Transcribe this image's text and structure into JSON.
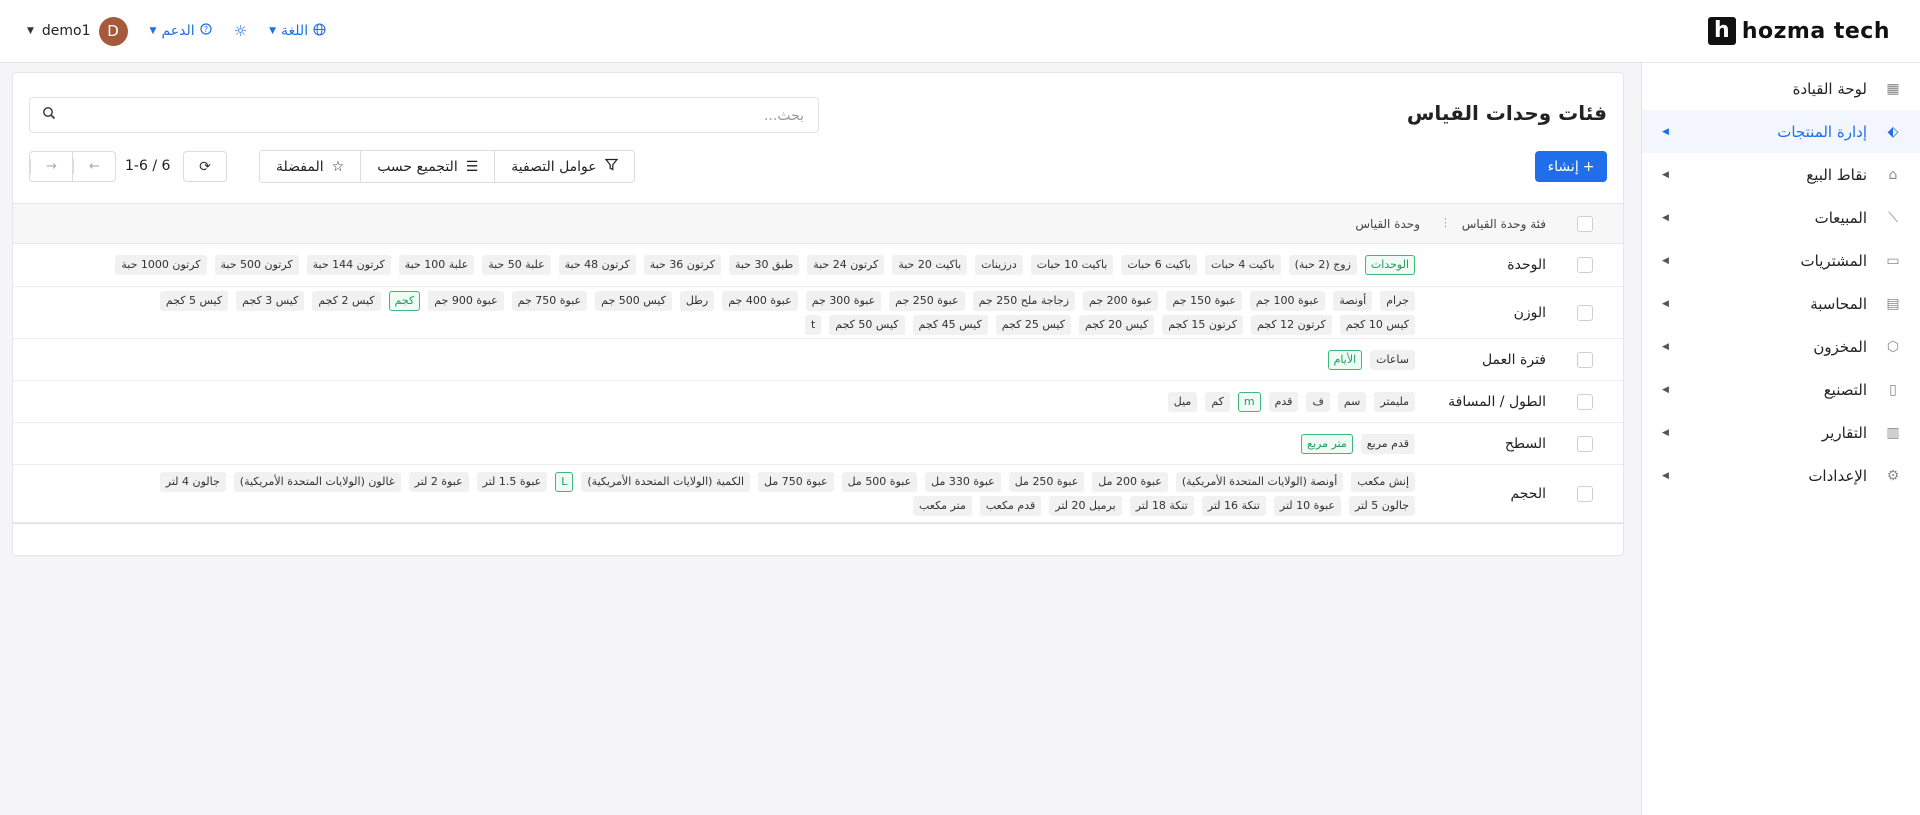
{
  "brand": {
    "logo_letter": "h",
    "name": "hozma tech"
  },
  "topbar": {
    "user_name": "demo1",
    "avatar_letter": "D",
    "support_label": "الدعم",
    "language_label": "اللغة"
  },
  "sidebar": {
    "items": [
      {
        "label": "لوحة القيادة",
        "icon": "grid-icon"
      },
      {
        "label": "إدارة المنتجات",
        "icon": "tag-icon",
        "active": true
      },
      {
        "label": "نقاط البيع",
        "icon": "store-icon"
      },
      {
        "label": "المبيعات",
        "icon": "chart-line-icon"
      },
      {
        "label": "المشتريات",
        "icon": "wallet-icon"
      },
      {
        "label": "المحاسبة",
        "icon": "ledger-icon"
      },
      {
        "label": "المخزون",
        "icon": "box-icon"
      },
      {
        "label": "التصنيع",
        "icon": "document-icon"
      },
      {
        "label": "التقارير",
        "icon": "report-icon"
      },
      {
        "label": "الإعدادات",
        "icon": "gear-icon"
      }
    ]
  },
  "page": {
    "title": "فئات وحدات القياس",
    "search_placeholder": "بحث...",
    "create_label": "إنشاء",
    "filters_label": "عوامل التصفية",
    "groupby_label": "التجميع حسب",
    "favorites_label": "المفضلة",
    "pager_text": "1-6 / 6"
  },
  "table": {
    "headers": {
      "name": "فئة وحدة القياس",
      "units": "وحدة القياس"
    },
    "rows": [
      {
        "name": "الوحدة",
        "units": [
          {
            "t": "الوحدات",
            "ref": true
          },
          {
            "t": "زوج (2 حبة)"
          },
          {
            "t": "باكيت 4 حبات"
          },
          {
            "t": "باكيت 6 حبات"
          },
          {
            "t": "باكيت 10 حبات"
          },
          {
            "t": "درزينات"
          },
          {
            "t": "باكيت 20 حبة"
          },
          {
            "t": "كرتون 24 حبة"
          },
          {
            "t": "طبق 30 حبة"
          },
          {
            "t": "كرتون 36 حبة"
          },
          {
            "t": "كرتون 48 حبة"
          },
          {
            "t": "علبة 50 حبة"
          },
          {
            "t": "علبة 100 حبة"
          },
          {
            "t": "كرتون 144 حبة"
          },
          {
            "t": "كرتون 500 حبة"
          },
          {
            "t": "كرتون 1000 حبة"
          }
        ]
      },
      {
        "name": "الوزن",
        "units": [
          {
            "t": "جرام"
          },
          {
            "t": "أونصة"
          },
          {
            "t": "عبوة 100 جم"
          },
          {
            "t": "عبوة 150 جم"
          },
          {
            "t": "عبوة 200 جم"
          },
          {
            "t": "زجاجة ملح 250 جم"
          },
          {
            "t": "عبوة 250 جم"
          },
          {
            "t": "عبوة 300 جم"
          },
          {
            "t": "عبوة 400 جم"
          },
          {
            "t": "رطل"
          },
          {
            "t": "كيس 500 جم"
          },
          {
            "t": "عبوة 750 جم"
          },
          {
            "t": "عبوة 900 جم"
          },
          {
            "t": "كجم",
            "ref": true
          },
          {
            "t": "كيس 2 كجم"
          },
          {
            "t": "كيس 3 كجم"
          },
          {
            "t": "كيس 5 كجم"
          },
          {
            "t": "كيس 10 كجم"
          },
          {
            "t": "كرتون 12 كجم"
          },
          {
            "t": "كرتون 15 كجم"
          },
          {
            "t": "كيس 20 كجم"
          },
          {
            "t": "كيس 25 كجم"
          },
          {
            "t": "كيس 45 كجم"
          },
          {
            "t": "كيس 50 كجم"
          },
          {
            "t": "t"
          }
        ]
      },
      {
        "name": "فترة العمل",
        "units": [
          {
            "t": "ساعات"
          },
          {
            "t": "الأيام",
            "ref": true
          }
        ]
      },
      {
        "name": "الطول / المسافة",
        "units": [
          {
            "t": "مليمتر"
          },
          {
            "t": "سم"
          },
          {
            "t": "ف"
          },
          {
            "t": "قدم"
          },
          {
            "t": "m",
            "ref": true
          },
          {
            "t": "كم"
          },
          {
            "t": "ميل"
          }
        ]
      },
      {
        "name": "السطح",
        "units": [
          {
            "t": "قدم مربع"
          },
          {
            "t": "متر مربع",
            "ref": true
          }
        ]
      },
      {
        "name": "الحجم",
        "units": [
          {
            "t": "إنش مكعب"
          },
          {
            "t": "أونصة (الولايات المتحدة الأمريكية)"
          },
          {
            "t": "عبوة 200 مل"
          },
          {
            "t": "عبوة 250 مل"
          },
          {
            "t": "عبوة 330 مل"
          },
          {
            "t": "عبوة 500 مل"
          },
          {
            "t": "عبوة 750 مل"
          },
          {
            "t": "الكمية (الولايات المتحدة الأمريكية)"
          },
          {
            "t": "L",
            "ref": true
          },
          {
            "t": "عبوة 1.5 لتر"
          },
          {
            "t": "عبوة 2 لتر"
          },
          {
            "t": "غالون (الولايات المتحدة الأمريكية)"
          },
          {
            "t": "جالون 4 لتر"
          },
          {
            "t": "جالون 5 لتر"
          },
          {
            "t": "عبوة 10 لتر"
          },
          {
            "t": "تنكة 16 لتر"
          },
          {
            "t": "تنكة 18 لتر"
          },
          {
            "t": "برميل 20 لتر"
          },
          {
            "t": "قدم مكعب"
          },
          {
            "t": "متر مكعب"
          }
        ]
      }
    ]
  }
}
